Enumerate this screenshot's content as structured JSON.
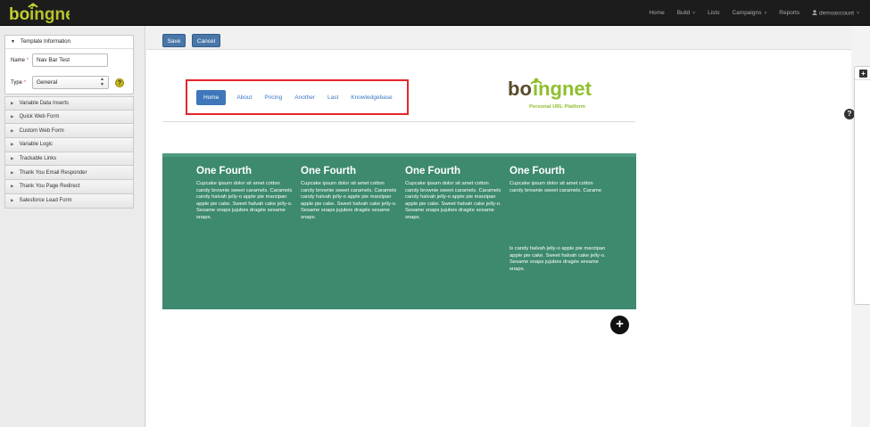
{
  "app": {
    "logo_text": "boingnet"
  },
  "topnav": {
    "items": [
      {
        "label": "Home"
      },
      {
        "label": "Build",
        "caret": "˅"
      },
      {
        "label": "Lists"
      },
      {
        "label": "Campaigns",
        "caret": "˅"
      },
      {
        "label": "Reports"
      },
      {
        "label": "demoaccount",
        "caret": "˅",
        "icon": "user-icon"
      }
    ]
  },
  "sidebar": {
    "panel_title": "Template Information",
    "name_label": "Name",
    "name_value": "Nav Bar Test",
    "type_label": "Type",
    "type_value": "General",
    "required_mark": "*",
    "help_symbol": "?",
    "accordion": [
      {
        "label": "Variable Data Inserts"
      },
      {
        "label": "Quick Web Form"
      },
      {
        "label": "Custom Web Form"
      },
      {
        "label": "Variable Logic"
      },
      {
        "label": "Trackable Links"
      },
      {
        "label": "Thank You Email Responder"
      },
      {
        "label": "Thank You Page Redirect"
      },
      {
        "label": "Salesforce Lead Form"
      }
    ]
  },
  "toolbar": {
    "save_label": "Save",
    "cancel_label": "Cancel"
  },
  "template": {
    "nav_links": [
      {
        "label": "Home",
        "active": true
      },
      {
        "label": "About"
      },
      {
        "label": "Pricing"
      },
      {
        "label": "Another"
      },
      {
        "label": "Last"
      },
      {
        "label": "Knowledgebase"
      }
    ],
    "brand": {
      "logo_text": "boingnet",
      "tagline": "Personal URL Platform",
      "accent_color": "#8fbf2d",
      "text_color": "#5a4a2a"
    },
    "section_color": "#3d8a6e",
    "columns": [
      {
        "heading": "One Fourth",
        "body": "Cupcake ipsum dolor sit amet cotton candy brownie sweet caramels. Caramels candy halvah jelly-o apple pie marzipan apple pie cake. Sweet halvah cake jelly-o. Sesame snaps jujubes dragée sesame snaps."
      },
      {
        "heading": "One Fourth",
        "body": "Cupcake ipsum dolor sit amet cotton candy brownie sweet caramels. Caramels candy halvah jelly-o apple pie marzipan apple pie cake. Sweet halvah cake jelly-o. Sesame snaps jujubes dragée sesame snaps."
      },
      {
        "heading": "One Fourth",
        "body": "Cupcake ipsum dolor sit amet cotton candy brownie sweet caramels. Caramels candy halvah jelly-o apple pie marzipan apple pie cake. Sweet halvah cake jelly-o. Sesame snaps jujubes dragée sesame snaps."
      },
      {
        "heading": "One Fourth",
        "body": "Cupcake ipsum dolor sit amet cotton candy brownie sweet caramels. Carame",
        "extra": "ls candy halvah jelly-o apple pie marzipan apple pie cake. Sweet halvah cake jelly-o. Sesame snaps jujubes dragée sesame snaps."
      }
    ],
    "add_symbol": "+"
  },
  "right": {
    "help_symbol": "?",
    "panel_icon": "plus-box-icon",
    "panel_icon_symbol": "+"
  }
}
